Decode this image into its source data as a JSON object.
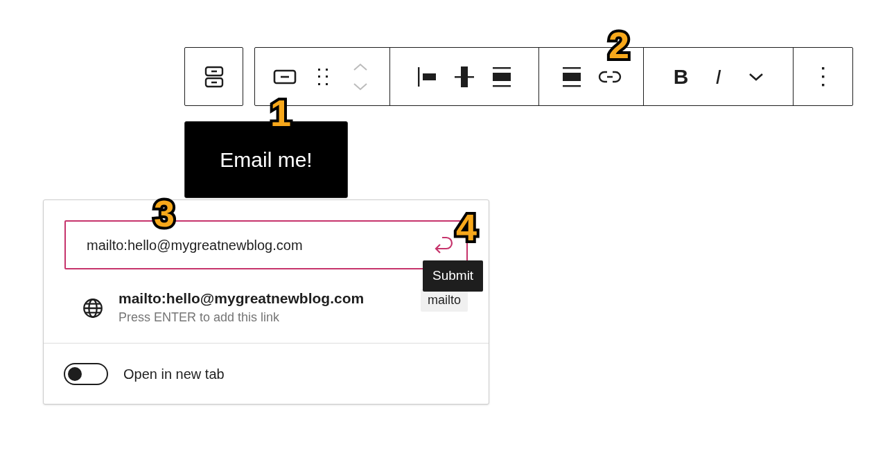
{
  "block_switcher": {
    "kind": "buttons"
  },
  "toolbar": {
    "groups": [
      {
        "buttons": [
          {
            "kind": "button-block",
            "disabled": false
          },
          {
            "kind": "drag",
            "disabled": false
          },
          {
            "kind": "mover",
            "disabled": true
          }
        ]
      },
      {
        "buttons": [
          {
            "kind": "justify-left",
            "disabled": false
          },
          {
            "kind": "justify-center",
            "disabled": false
          },
          {
            "kind": "justify-stretch",
            "disabled": false
          }
        ]
      },
      {
        "buttons": [
          {
            "kind": "justify-stretch",
            "disabled": false
          },
          {
            "kind": "link",
            "disabled": false
          }
        ]
      },
      {
        "buttons": [
          {
            "kind": "bold",
            "label": "B"
          },
          {
            "kind": "italic",
            "label": "I"
          },
          {
            "kind": "chevron-down",
            "disabled": false
          }
        ]
      },
      {
        "buttons": [
          {
            "kind": "more",
            "disabled": false
          }
        ]
      }
    ]
  },
  "block_button": {
    "label": "Email me!"
  },
  "link_popover": {
    "url_field": {
      "value": "mailto:hello@mygreatnewblog.com"
    },
    "submit_tooltip": "Submit",
    "suggestion": {
      "title": "mailto:hello@mygreatnewblog.com",
      "hint": "Press ENTER to add this link",
      "type": "mailto"
    },
    "open_in_new_tab": {
      "label": "Open in new tab",
      "on": false
    }
  },
  "callouts": [
    {
      "label": "1"
    },
    {
      "label": "2"
    },
    {
      "label": "3"
    },
    {
      "label": "4"
    }
  ]
}
